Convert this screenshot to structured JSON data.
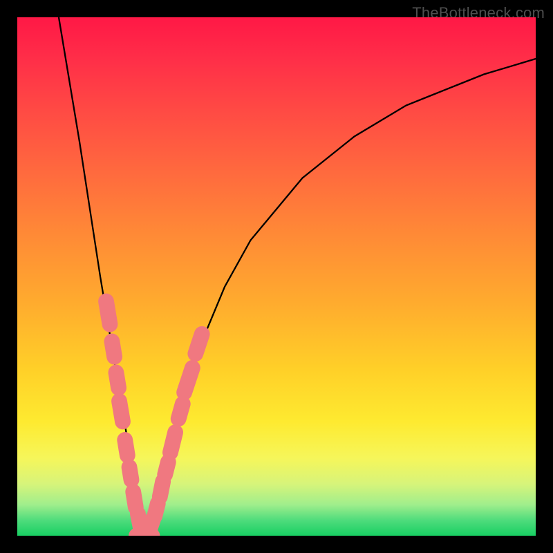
{
  "watermark": "TheBottleneck.com",
  "colors": {
    "curve": "#000000",
    "marker_fill": "#f07880",
    "marker_stroke": "#e85b65",
    "gradient_top": "#ff1846",
    "gradient_bottom": "#18cf63"
  },
  "chart_data": {
    "type": "line",
    "title": "",
    "xlabel": "",
    "ylabel": "",
    "xlim": [
      0,
      100
    ],
    "ylim": [
      0,
      100
    ],
    "note": "x and y estimated on a 0–100 normalized axis; two black curves forming a deep V whose tip sits near x≈24, y≈0, with pink bead-like markers on the lower segments of both arms.",
    "series": [
      {
        "name": "left-arm",
        "x": [
          8,
          10,
          12,
          14,
          16,
          18,
          20,
          21,
          22,
          23,
          24,
          25
        ],
        "y": [
          100,
          88,
          76,
          63,
          50,
          38,
          26,
          20,
          14,
          8,
          3,
          0
        ]
      },
      {
        "name": "right-arm",
        "x": [
          25,
          26,
          27,
          28,
          30,
          32,
          35,
          40,
          45,
          50,
          55,
          60,
          65,
          70,
          75,
          80,
          85,
          90,
          95,
          100
        ],
        "y": [
          0,
          3,
          7,
          12,
          20,
          27,
          36,
          48,
          57,
          63,
          69,
          73,
          77,
          80,
          83,
          85,
          87,
          89,
          90.5,
          92
        ]
      }
    ],
    "markers": [
      {
        "series": "left-arm",
        "x": 17.5,
        "y": 43,
        "len": 4.5
      },
      {
        "series": "left-arm",
        "x": 18.5,
        "y": 36,
        "len": 3.0
      },
      {
        "series": "left-arm",
        "x": 19.3,
        "y": 30,
        "len": 3.0
      },
      {
        "series": "left-arm",
        "x": 20.0,
        "y": 24,
        "len": 4.0
      },
      {
        "series": "left-arm",
        "x": 21.0,
        "y": 17,
        "len": 3.0
      },
      {
        "series": "left-arm",
        "x": 21.8,
        "y": 12,
        "len": 2.5
      },
      {
        "series": "left-arm",
        "x": 22.6,
        "y": 7,
        "len": 3.0
      },
      {
        "series": "left-arm",
        "x": 23.5,
        "y": 3,
        "len": 2.5
      },
      {
        "series": "floor",
        "x": 24.5,
        "y": 0,
        "len": 3.0
      },
      {
        "series": "right-arm",
        "x": 25.8,
        "y": 2,
        "len": 3.0
      },
      {
        "series": "right-arm",
        "x": 26.8,
        "y": 5,
        "len": 2.5
      },
      {
        "series": "right-arm",
        "x": 27.8,
        "y": 9,
        "len": 3.0
      },
      {
        "series": "right-arm",
        "x": 28.8,
        "y": 13,
        "len": 2.5
      },
      {
        "series": "right-arm",
        "x": 30.0,
        "y": 18,
        "len": 4.0
      },
      {
        "series": "right-arm",
        "x": 31.5,
        "y": 24,
        "len": 3.0
      },
      {
        "series": "right-arm",
        "x": 33.0,
        "y": 30,
        "len": 5.0
      },
      {
        "series": "right-arm",
        "x": 35.0,
        "y": 37,
        "len": 4.0
      }
    ],
    "marker_width": 1.6
  }
}
